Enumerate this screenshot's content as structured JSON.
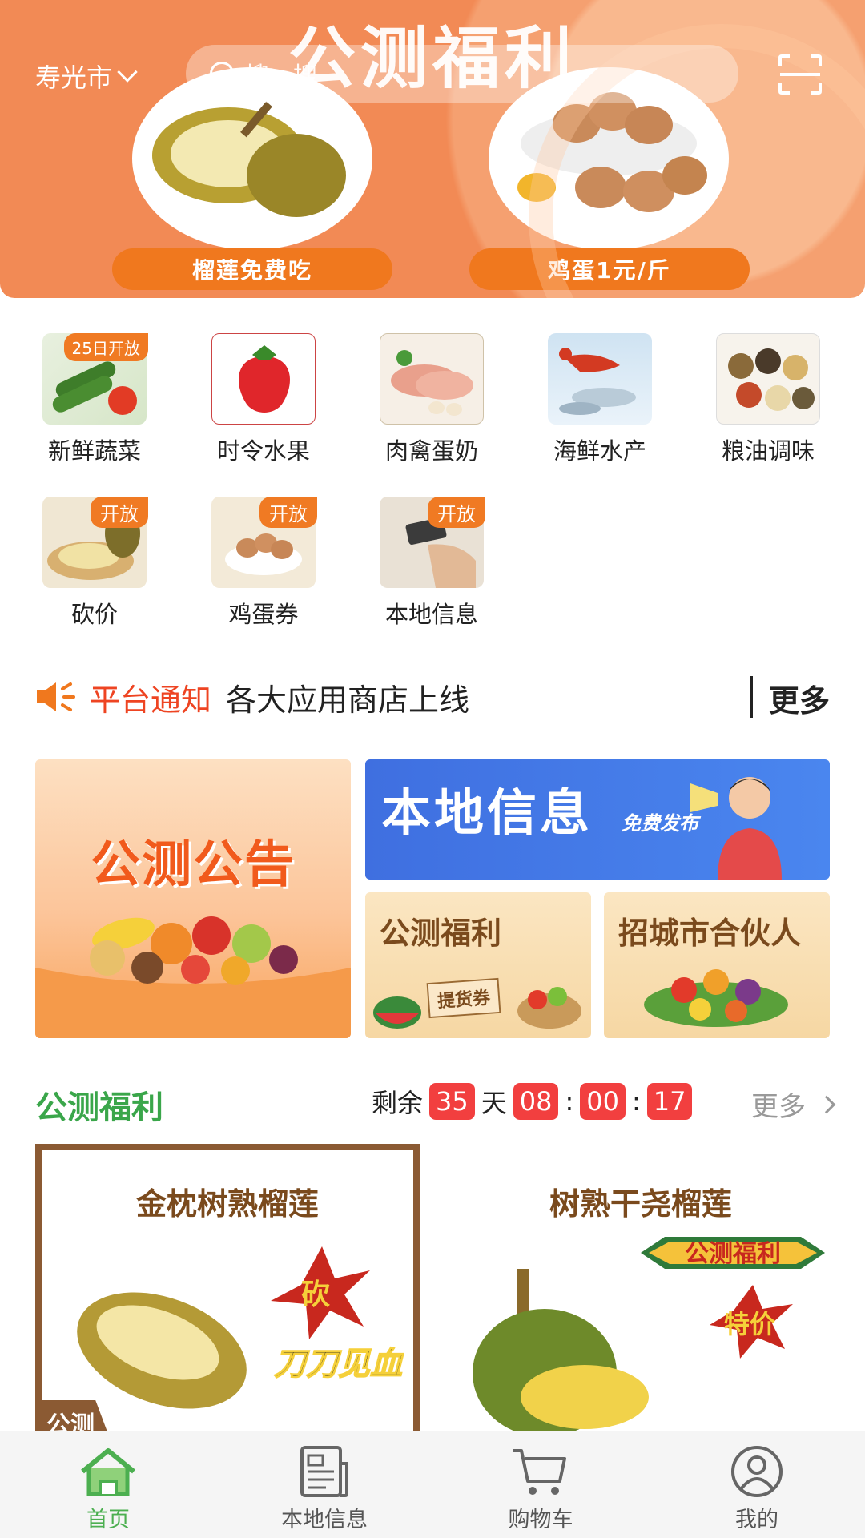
{
  "header": {
    "banner_title": "公测福利",
    "city": "寿光市",
    "search_placeholder": "搜一搜",
    "promo_left": "榴莲免费吃",
    "promo_right": "鸡蛋1元/斤"
  },
  "categories": [
    {
      "label": "新鲜蔬菜",
      "badge": "25日开放"
    },
    {
      "label": "时令水果",
      "badge": ""
    },
    {
      "label": "肉禽蛋奶",
      "badge": ""
    },
    {
      "label": "海鲜水产",
      "badge": ""
    },
    {
      "label": "粮油调味",
      "badge": ""
    },
    {
      "label": "砍价",
      "badge": "开放"
    },
    {
      "label": "鸡蛋券",
      "badge": "开放"
    },
    {
      "label": "本地信息",
      "badge": "开放"
    }
  ],
  "notice": {
    "label": "平台通知",
    "text": "各大应用商店上线",
    "more": "更多"
  },
  "promos": {
    "announcement": "公测公告",
    "local_info": "本地信息",
    "local_info_sub": "免费发布",
    "welfare": "公测福利",
    "welfare_coupon": "提货券",
    "partner": "招城市合伙人"
  },
  "welfare_section": {
    "title": "公测福利",
    "remaining": "剩余",
    "days": "35",
    "day_unit": "天",
    "hours": "08",
    "minutes": "00",
    "seconds": "17",
    "sep": ":",
    "more": "更多",
    "products": [
      {
        "name": "金枕树熟榴莲",
        "tag": "公测",
        "stamp": "砍",
        "slogan": "刀刀见血"
      },
      {
        "name": "树熟干尧榴莲",
        "banner": "公测福利",
        "stamp": "特价"
      }
    ]
  },
  "tabbar": [
    {
      "label": "首页",
      "icon": "home-icon",
      "active": true
    },
    {
      "label": "本地信息",
      "icon": "document-icon",
      "active": false
    },
    {
      "label": "购物车",
      "icon": "cart-icon",
      "active": false
    },
    {
      "label": "我的",
      "icon": "user-icon",
      "active": false
    }
  ],
  "colors": {
    "accent_orange": "#f0781e",
    "accent_green": "#3aa64a",
    "countdown_red": "#f23f3f",
    "notice_red": "#ee4422",
    "brown": "#8b5a33"
  }
}
